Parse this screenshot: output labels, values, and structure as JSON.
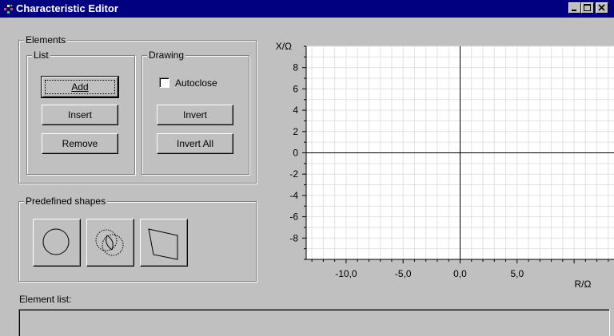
{
  "window": {
    "title": "Characteristic Editor"
  },
  "elements_group": {
    "label": "Elements",
    "list_group": {
      "label": "List",
      "add_button": "Add",
      "insert_button": "Insert",
      "remove_button": "Remove"
    },
    "drawing_group": {
      "label": "Drawing",
      "autoclose_label": "Autoclose",
      "autoclose_checked": false,
      "invert_button": "Invert",
      "invert_all_button": "Invert All"
    }
  },
  "predefined_shapes": {
    "label": "Predefined shapes",
    "shapes": [
      "circle-icon",
      "intersecting-circles-icon",
      "quadrilateral-icon"
    ]
  },
  "element_list": {
    "label": "Element list:"
  },
  "chart_data": {
    "type": "scatter",
    "xlabel": "R/Ω",
    "ylabel": "X/Ω",
    "x_ticks": [
      "-10,0",
      "-5,0",
      "0,0",
      "5,0"
    ],
    "x_tick_values": [
      -10,
      -5,
      0,
      5
    ],
    "y_ticks": [
      "8",
      "6",
      "4",
      "2",
      "0",
      "-2",
      "-4",
      "-6",
      "-8"
    ],
    "y_tick_values": [
      8,
      6,
      4,
      2,
      0,
      -2,
      -4,
      -6,
      -8
    ],
    "xlim": [
      -13.5,
      13.5
    ],
    "ylim": [
      -10,
      10
    ],
    "grid": true,
    "series": []
  }
}
